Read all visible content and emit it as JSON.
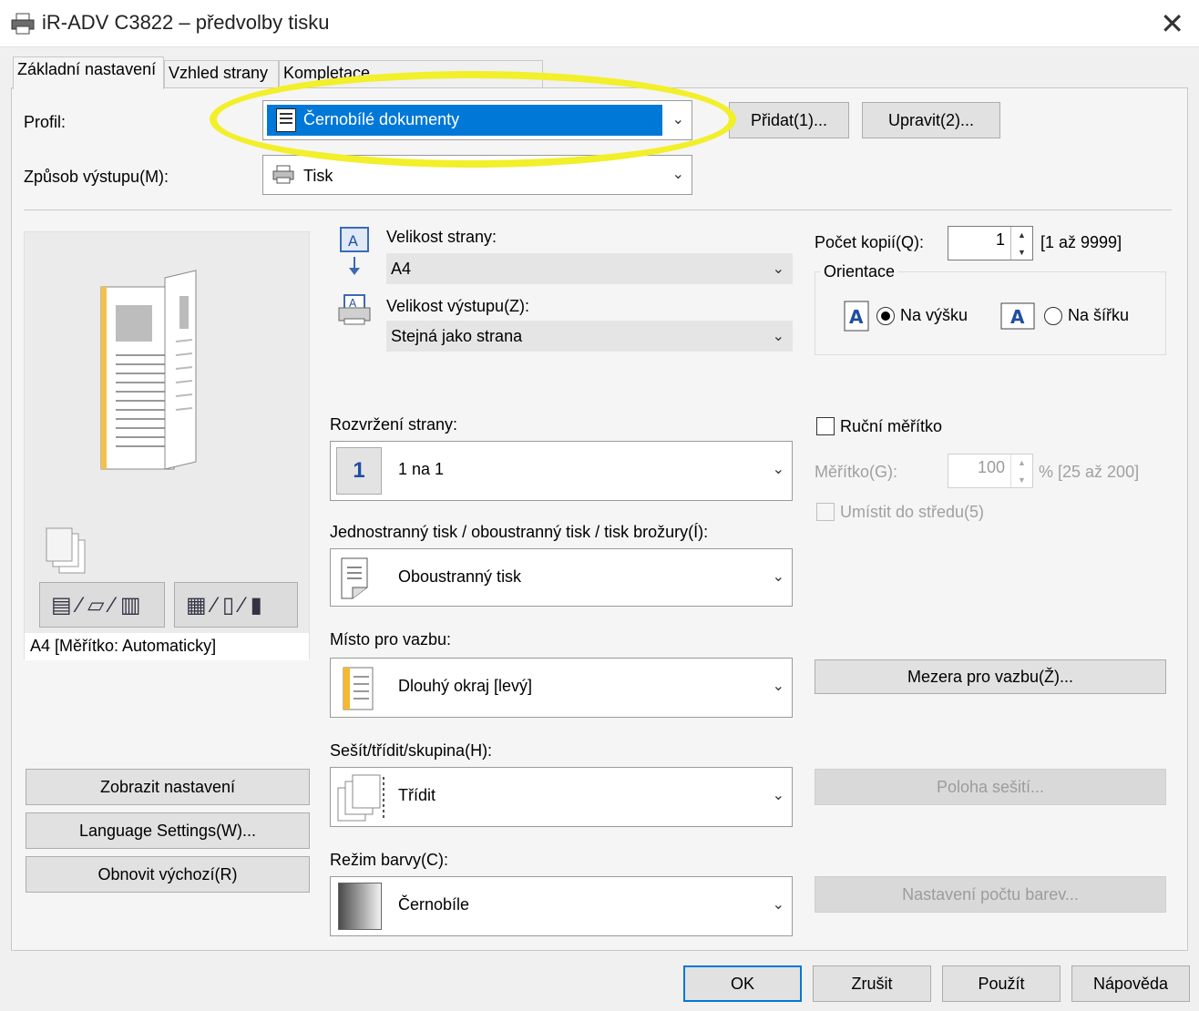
{
  "window": {
    "title": "iR-ADV C3822 – předvolby tisku",
    "close_glyph": "✕"
  },
  "tabs": [
    {
      "label": "Základní nastavení"
    },
    {
      "label": "Vzhled strany"
    },
    {
      "label": "Kompletace"
    }
  ],
  "profile": {
    "label": "Profil:",
    "value": "Černobílé dokumenty",
    "add_button": "Přidat(1)...",
    "edit_button": "Upravit(2)..."
  },
  "output": {
    "label": "Způsob výstupu(M):",
    "value": "Tisk"
  },
  "preview": {
    "caption": "A4 [Měřítko: Automaticky]",
    "show_settings_button": "Zobrazit nastavení",
    "language_button": "Language Settings(W)...",
    "restore_button": "Obnovit výchozí(R)"
  },
  "page_size": {
    "label": "Velikost strany:",
    "value": "A4"
  },
  "output_size": {
    "label": "Velikost výstupu(Z):",
    "value": "Stejná jako strana"
  },
  "copies": {
    "label": "Počet kopií(Q):",
    "value": "1",
    "range": "[1 až 9999]"
  },
  "orientation": {
    "label": "Orientace",
    "portrait": "Na výšku",
    "landscape": "Na šířku",
    "selected": "portrait"
  },
  "layout": {
    "label": "Rozvržení strany:",
    "value": "1 na 1",
    "icon_text": "1"
  },
  "manual_scale": {
    "label": "Ruční měřítko",
    "scale_label": "Měřítko(G):",
    "scale_value": "100",
    "scale_range": "% [25 až 200]",
    "center_label": "Umístit do středu(5)"
  },
  "duplex": {
    "label": "Jednostranný tisk / oboustranný tisk / tisk brožury(Í):",
    "value": "Oboustranný tisk"
  },
  "binding": {
    "label": "Místo pro vazbu:",
    "value": "Dlouhý okraj [levý]",
    "gap_button": "Mezera pro vazbu(Ž)..."
  },
  "finishing": {
    "label": "Sešít/třídit/skupina(H):",
    "value": "Třídit",
    "staple_button": "Poloha sešití..."
  },
  "color_mode": {
    "label": "Režim barvy(C):",
    "value": "Černobíle",
    "color_count_button": "Nastavení počtu barev..."
  },
  "footer": {
    "ok": "OK",
    "cancel": "Zrušit",
    "apply": "Použít",
    "help": "Nápověda"
  },
  "colors": {
    "selection_blue": "#0078d7",
    "highlight_ellipse": "#f2ef2b"
  }
}
